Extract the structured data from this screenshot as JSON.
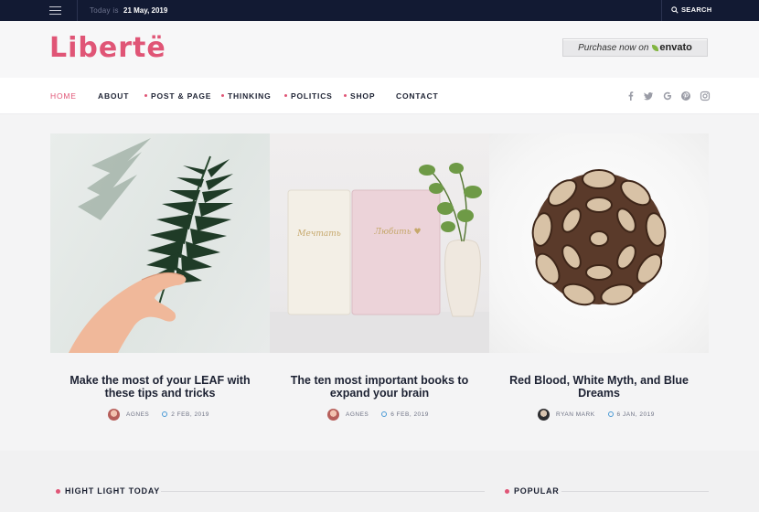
{
  "topbar": {
    "date_label": "Today is",
    "date_value": "21 May, 2019",
    "search_label": "SEARCH"
  },
  "header": {
    "logo_text": "Libertë",
    "envato_prefix": "Purchase now on",
    "envato_brand": "envato"
  },
  "nav": {
    "items": [
      {
        "label": "HOME",
        "active": true,
        "dot": false
      },
      {
        "label": "ABOUT",
        "active": false,
        "dot": false
      },
      {
        "label": "POST & PAGE",
        "active": false,
        "dot": true
      },
      {
        "label": "THINKING",
        "active": false,
        "dot": true
      },
      {
        "label": "POLITICS",
        "active": false,
        "dot": true
      },
      {
        "label": "SHOP",
        "active": false,
        "dot": true
      },
      {
        "label": "CONTACT",
        "active": false,
        "dot": false
      }
    ],
    "social": [
      "facebook-icon",
      "twitter-icon",
      "google-icon",
      "pinterest-icon",
      "instagram-icon"
    ]
  },
  "posts": [
    {
      "title": "Make the most of your LEAF with these tips and tricks",
      "author": "AGNES",
      "date": "2 FEB, 2019"
    },
    {
      "title": "The ten most important books to expand your brain",
      "author": "AGNES",
      "date": "6 FEB, 2019"
    },
    {
      "title": "Red Blood, White Myth, and Blue Dreams",
      "author": "RYAN MARK",
      "date": "6 JAN, 2019"
    }
  ],
  "sections": {
    "highlight": "HIGHT LIGHT TODAY",
    "popular": "POPULAR"
  },
  "colors": {
    "accent": "#e05576",
    "topbar": "#121a33",
    "text": "#1d2233"
  }
}
